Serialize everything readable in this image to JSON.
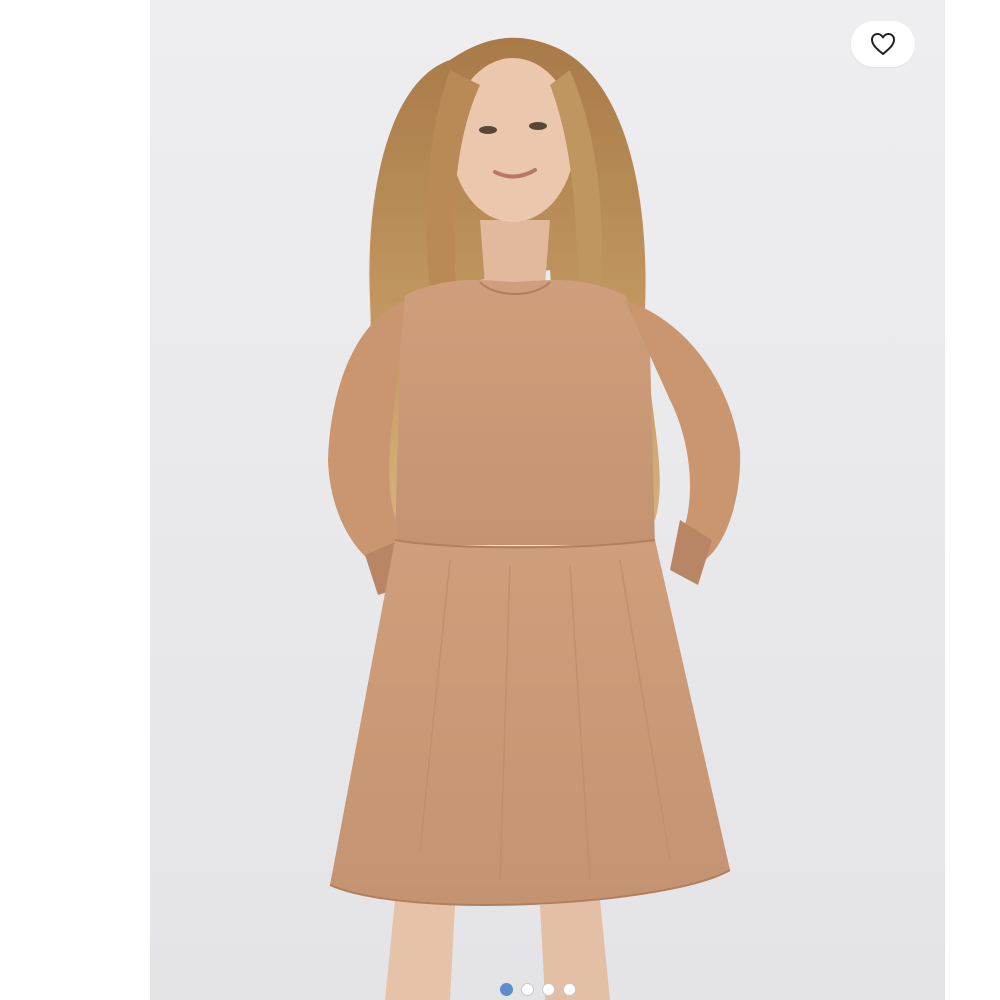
{
  "product": {
    "image_subject": "model-in-tan-sweatshirt-babydoll-dress",
    "dress_color": "#c99a78",
    "background_color": "#ececee"
  },
  "favorite": {
    "icon": "heart-outline-icon",
    "active": false
  },
  "carousel": {
    "total": 4,
    "active_index": 0,
    "active_color": "#5b8fc8"
  }
}
